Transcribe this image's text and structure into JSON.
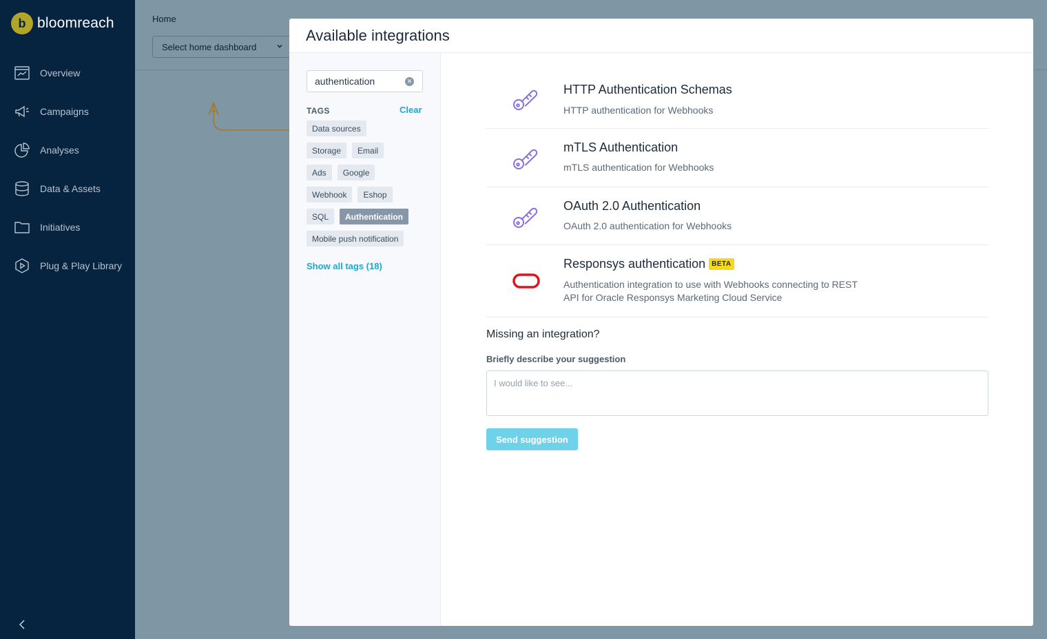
{
  "sidebar": {
    "brand": "bloomreach",
    "logo_letter": "b",
    "items": [
      {
        "label": "Overview"
      },
      {
        "label": "Campaigns"
      },
      {
        "label": "Analyses"
      },
      {
        "label": "Data & Assets"
      },
      {
        "label": "Initiatives"
      },
      {
        "label": "Plug & Play Library"
      }
    ]
  },
  "background": {
    "breadcrumb": "Home",
    "dashboard_select": "Select home dashboard"
  },
  "modal": {
    "title": "Available integrations",
    "search": {
      "value": "authentication"
    },
    "tags_label": "TAGS",
    "clear_label": "Clear",
    "tag_rows": [
      [
        {
          "label": "Data sources",
          "active": false
        }
      ],
      [
        {
          "label": "Storage",
          "active": false
        },
        {
          "label": "Email",
          "active": false
        }
      ],
      [
        {
          "label": "Ads",
          "active": false
        },
        {
          "label": "Google",
          "active": false
        }
      ],
      [
        {
          "label": "Webhook",
          "active": false
        },
        {
          "label": "Eshop",
          "active": false
        }
      ],
      [
        {
          "label": "SQL",
          "active": false
        },
        {
          "label": "Authentication",
          "active": true
        }
      ],
      [
        {
          "label": "Mobile push notification",
          "active": false
        }
      ]
    ],
    "show_all": "Show all tags (18)",
    "integrations": [
      {
        "name": "HTTP Authentication Schemas",
        "desc": "HTTP authentication for Webhooks",
        "icon": "key-icon",
        "beta": ""
      },
      {
        "name": "mTLS Authentication",
        "desc": "mTLS authentication for Webhooks",
        "icon": "key-icon",
        "beta": ""
      },
      {
        "name": "OAuth 2.0 Authentication",
        "desc": "OAuth 2.0 authentication for Webhooks",
        "icon": "key-icon",
        "beta": ""
      },
      {
        "name": "Responsys authentication",
        "desc": "Authentication integration to use with Webhooks connecting to REST API for Oracle Responsys Marketing Cloud Service",
        "icon": "oracle-logo-icon",
        "beta": "BETA"
      }
    ],
    "missing": {
      "title": "Missing an integration?",
      "label": "Briefly describe your suggestion",
      "placeholder": "I would like to see...",
      "button": "Send suggestion"
    }
  },
  "colors": {
    "sidebar_bg": "#06233f",
    "accent": "#1aa8d6",
    "key_icon": "#8a6fe0",
    "oracle_red": "#e0141e",
    "beta_badge": "#f9d71c"
  }
}
